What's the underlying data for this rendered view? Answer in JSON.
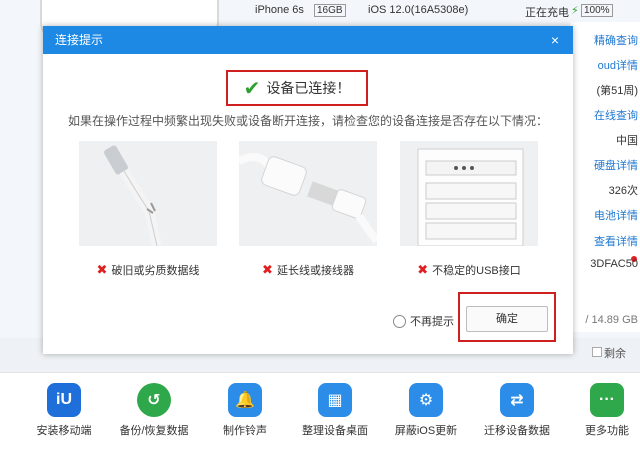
{
  "device": {
    "model": "iPhone 6s",
    "storage": "16GB",
    "ios": "iOS 12.0(16A5308e)",
    "charging": "正在充电",
    "battery": "100%"
  },
  "right_panel": {
    "items": [
      "精确查询",
      "oud详情",
      "(第51周)",
      "在线查询",
      "中国",
      "硬盘详情",
      "326次",
      "电池详情",
      "查看详情",
      "3DFAC50"
    ],
    "storage_text": "/ 14.89 GB",
    "remaining_label": "剩余"
  },
  "dialog": {
    "title": "连接提示",
    "close": "×",
    "status": "设备已连接！",
    "description": "如果在操作过程中频繁出现失败或设备断开连接，请检查您的设备连接是否存在以下情况：",
    "captions": [
      "破旧或劣质数据线",
      "延长线或接线器",
      "不稳定的USB接口"
    ],
    "no_remind": "不再提示",
    "confirm": "确定"
  },
  "bottom_bar": {
    "items": [
      {
        "label": "安装移动端",
        "color": "#1e6fd9",
        "glyph": "iU"
      },
      {
        "label": "备份/恢复数据",
        "color": "#2ea84a",
        "glyph": "↺"
      },
      {
        "label": "制作铃声",
        "color": "#2b8de8",
        "glyph": "🔔"
      },
      {
        "label": "整理设备桌面",
        "color": "#2b8de8",
        "glyph": "▦"
      },
      {
        "label": "屏蔽iOS更新",
        "color": "#2b8de8",
        "glyph": "⚙"
      },
      {
        "label": "迁移设备数据",
        "color": "#2b8de8",
        "glyph": "⇄"
      },
      {
        "label": "更多功能",
        "color": "#2ea84a",
        "glyph": "···"
      }
    ]
  }
}
